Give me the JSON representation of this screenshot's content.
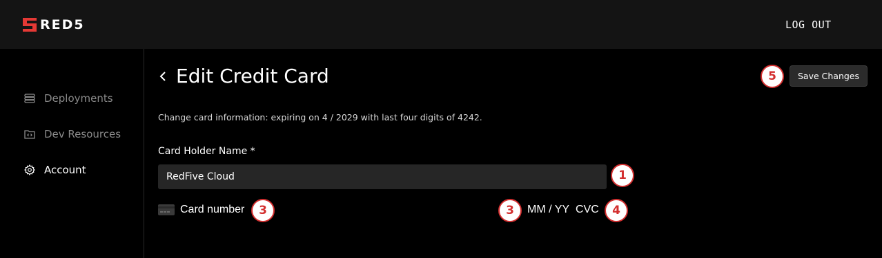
{
  "header": {
    "brand": "RED5",
    "logout_label": "LOG OUT",
    "brand_color": "#e53935"
  },
  "sidebar": {
    "items": [
      {
        "label": "Deployments",
        "icon": "server-stack-icon",
        "active": false
      },
      {
        "label": "Dev Resources",
        "icon": "code-folder-icon",
        "active": false
      },
      {
        "label": "Account",
        "icon": "gear-icon",
        "active": true
      }
    ]
  },
  "main": {
    "title": "Edit Credit Card",
    "save_label": "Save Changes",
    "description": "Change card information: expiring on 4 / 2029 with last four digits of 4242.",
    "card_holder_label": "Card Holder Name *",
    "card_holder_value": "RedFive Cloud",
    "card_number_placeholder": "Card number",
    "expiry_placeholder": "MM / YY",
    "cvc_placeholder": "CVC"
  },
  "annotations": [
    "1",
    "3",
    "3",
    "4",
    "5"
  ],
  "colors": {
    "annotation_red": "#d32f2f",
    "input_bg": "#262626",
    "topbar_bg": "#141414"
  }
}
